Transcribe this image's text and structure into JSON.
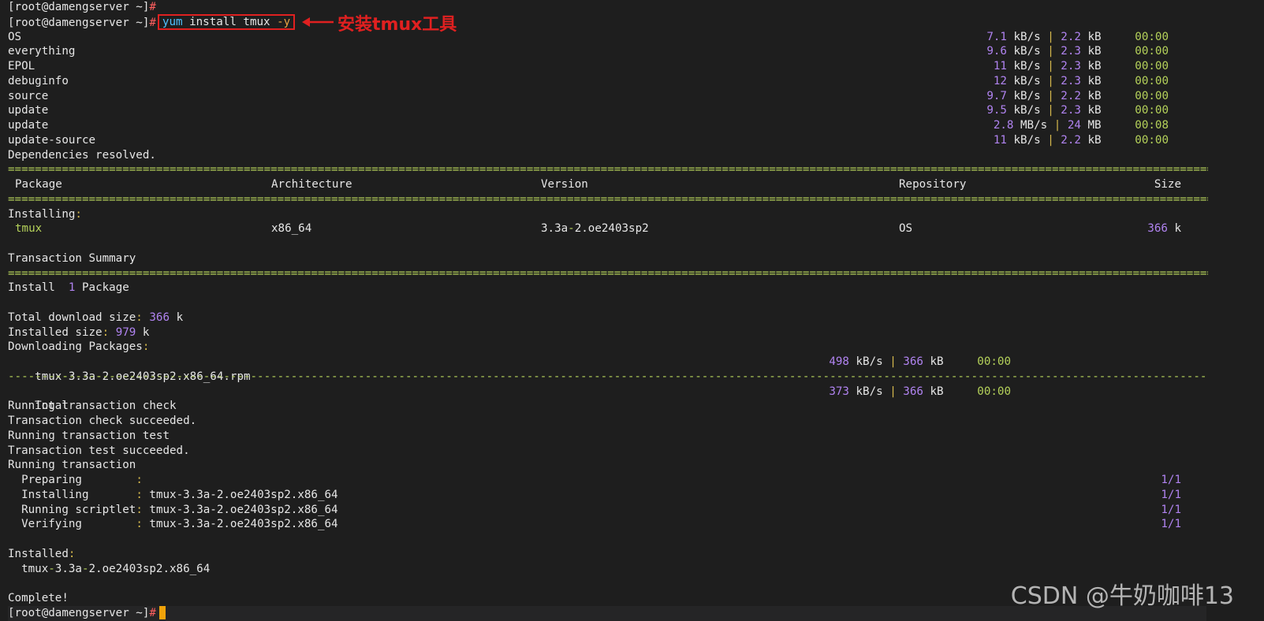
{
  "prompt": "[root@damengserver ~]",
  "hash": "#",
  "command": {
    "cmd": "yum",
    "rest": " install tmux ",
    "flag": "-y"
  },
  "annotation": "安装tmux工具",
  "repos": [
    {
      "name": "OS",
      "rate": "7.1",
      "rate_unit": "kB/s",
      "size": "2.2",
      "size_unit": "kB",
      "time": "00:00"
    },
    {
      "name": "everything",
      "rate": "9.6",
      "rate_unit": "kB/s",
      "size": "2.3",
      "size_unit": "kB",
      "time": "00:00"
    },
    {
      "name": "EPOL",
      "rate": "11",
      "rate_unit": "kB/s",
      "size": "2.3",
      "size_unit": "kB",
      "time": "00:00"
    },
    {
      "name": "debuginfo",
      "rate": "12",
      "rate_unit": "kB/s",
      "size": "2.3",
      "size_unit": "kB",
      "time": "00:00"
    },
    {
      "name": "source",
      "rate": "9.7",
      "rate_unit": "kB/s",
      "size": "2.2",
      "size_unit": "kB",
      "time": "00:00"
    },
    {
      "name": "update",
      "rate": "9.5",
      "rate_unit": "kB/s",
      "size": "2.3",
      "size_unit": "kB",
      "time": "00:00"
    },
    {
      "name": "update",
      "rate": "2.8",
      "rate_unit": "MB/s",
      "size": "24",
      "size_unit": "MB",
      "time": "00:08"
    },
    {
      "name": "update-source",
      "rate": "11",
      "rate_unit": "kB/s",
      "size": "2.2",
      "size_unit": "kB",
      "time": "00:00"
    }
  ],
  "deps_resolved": "Dependencies resolved.",
  "table_headers": {
    "package": "Package",
    "arch": "Architecture",
    "version": "Version",
    "repo": "Repository",
    "size": "Size"
  },
  "installing_label": "Installing",
  "package_row": {
    "name": "tmux",
    "arch": "x86_64",
    "version": "3.3a-2.oe2403sp2",
    "repo": "OS",
    "size": "366",
    "size_unit": "k"
  },
  "transaction_summary": "Transaction Summary",
  "install_summary": {
    "label": "Install",
    "count": "1",
    "unit": "Package"
  },
  "total_download": {
    "label": "Total download size",
    "value": "366",
    "unit": "k"
  },
  "installed_size": {
    "label": "Installed size",
    "value": "979",
    "unit": "k"
  },
  "downloading_packages": "Downloading Packages",
  "rpm_download": {
    "file": "tmux-3.3a-2.oe2403sp2.x86_64.rpm",
    "rate": "498",
    "rate_unit": "kB/s",
    "size": "366",
    "size_unit": "kB",
    "time": "00:00"
  },
  "total_row": {
    "label": "Total",
    "rate": "373",
    "rate_unit": "kB/s",
    "size": "366",
    "size_unit": "kB",
    "time": "00:00"
  },
  "steps": [
    "Running transaction check",
    "Transaction check succeeded.",
    "Running transaction test",
    "Transaction test succeeded.",
    "Running transaction"
  ],
  "tx_rows": [
    {
      "action": "Preparing        ",
      "pkg": "",
      "count": "1/1"
    },
    {
      "action": "Installing       ",
      "pkg": "tmux-3.3a-2.oe2403sp2.x86_64",
      "count": "1/1"
    },
    {
      "action": "Running scriptlet",
      "pkg": "tmux-3.3a-2.oe2403sp2.x86_64",
      "count": "1/1"
    },
    {
      "action": "Verifying        ",
      "pkg": "tmux-3.3a-2.oe2403sp2.x86_64",
      "count": "1/1"
    }
  ],
  "installed_label": "Installed",
  "installed_pkg": "tmux-3.3a-2.oe2403sp2.x86_64",
  "complete": "Complete!",
  "watermark": "CSDN @牛奶咖啡13",
  "colors": {
    "accent_red": "#e02020",
    "purple": "#b083f0",
    "green": "#b5d25a",
    "cursor": "#f0a30a"
  }
}
